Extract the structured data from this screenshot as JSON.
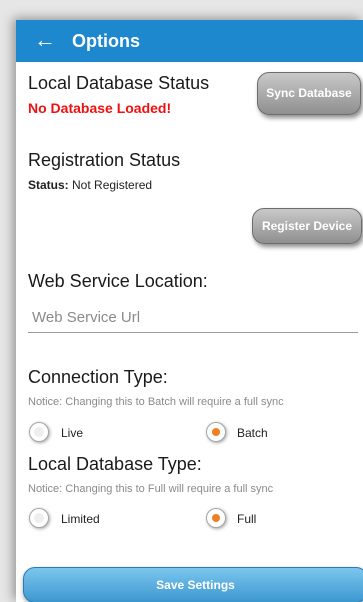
{
  "appbar": {
    "back_icon": "arrow-left-icon",
    "back_glyph": "←",
    "title": "Options"
  },
  "database": {
    "heading": "Local Database Status",
    "status_text": "No Database Loaded!",
    "sync_button": "Sync Database"
  },
  "registration": {
    "heading": "Registration Status",
    "status_label": "Status:",
    "status_value": "Not Registered",
    "register_button": "Register Device"
  },
  "web_service": {
    "heading": "Web Service Location:",
    "value": "",
    "placeholder": "Web Service Url"
  },
  "connection_type": {
    "heading": "Connection Type:",
    "notice": "Notice: Changing this to Batch will require a full sync",
    "options": [
      {
        "label": "Live",
        "selected": false
      },
      {
        "label": "Batch",
        "selected": true
      }
    ]
  },
  "database_type": {
    "heading": "Local Database Type:",
    "notice": "Notice: Changing this to Full will require a full sync",
    "options": [
      {
        "label": "Limited",
        "selected": false
      },
      {
        "label": "Full",
        "selected": true
      }
    ]
  },
  "save_button": "Save Settings",
  "colors": {
    "appbar": "#1e88cf",
    "error": "#ee1111",
    "radio_selected": "#f07e22",
    "save_button": "#4aa3da"
  }
}
